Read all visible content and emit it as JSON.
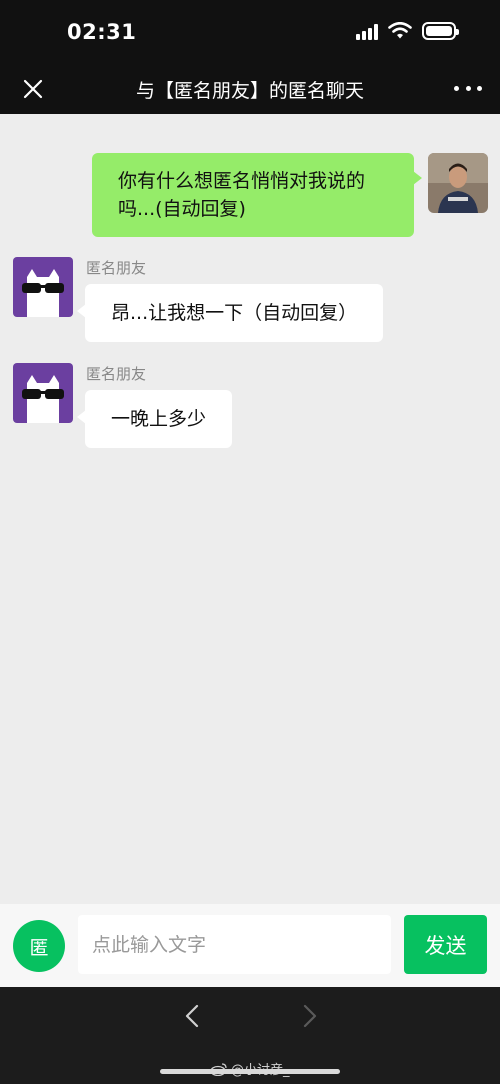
{
  "status_bar": {
    "time": "02:31"
  },
  "header": {
    "title": "与【匿名朋友】的匿名聊天"
  },
  "messages": [
    {
      "from": "me",
      "text": "你有什么想匿名悄悄对我说的吗...(自动回复)"
    },
    {
      "from": "other",
      "sender": "匿名朋友",
      "text": "昂...让我想一下（自动回复）"
    },
    {
      "from": "other",
      "sender": "匿名朋友",
      "text": "一晚上多少"
    }
  ],
  "input_bar": {
    "anon_label": "匿",
    "placeholder": "点此输入文字",
    "send_label": "发送"
  },
  "watermark": {
    "text": "@小讨彦_"
  },
  "colors": {
    "my_bubble": "#95ec69",
    "accent_green": "#07c160",
    "avatar_purple": "#6b3fa0",
    "header_bg": "#111111",
    "chat_bg": "#ededed"
  },
  "icons": [
    "close-icon",
    "more-icon",
    "signal-icon",
    "wifi-icon",
    "battery-icon",
    "back-icon",
    "forward-icon",
    "weibo-icon"
  ]
}
